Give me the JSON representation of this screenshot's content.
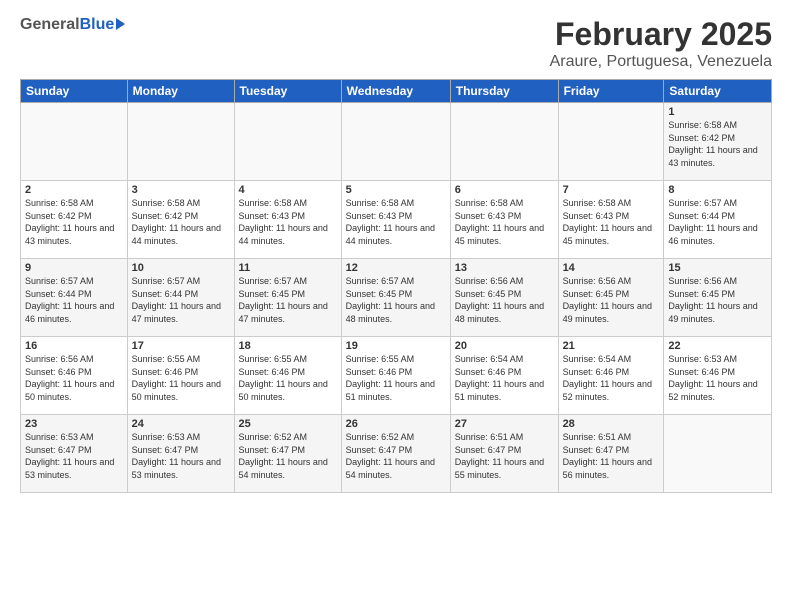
{
  "header": {
    "logo_general": "General",
    "logo_blue": "Blue",
    "title": "February 2025",
    "subtitle": "Araure, Portuguesa, Venezuela"
  },
  "days_of_week": [
    "Sunday",
    "Monday",
    "Tuesday",
    "Wednesday",
    "Thursday",
    "Friday",
    "Saturday"
  ],
  "weeks": [
    [
      {
        "day": "",
        "info": ""
      },
      {
        "day": "",
        "info": ""
      },
      {
        "day": "",
        "info": ""
      },
      {
        "day": "",
        "info": ""
      },
      {
        "day": "",
        "info": ""
      },
      {
        "day": "",
        "info": ""
      },
      {
        "day": "1",
        "info": "Sunrise: 6:58 AM\nSunset: 6:42 PM\nDaylight: 11 hours and 43 minutes."
      }
    ],
    [
      {
        "day": "2",
        "info": "Sunrise: 6:58 AM\nSunset: 6:42 PM\nDaylight: 11 hours and 43 minutes."
      },
      {
        "day": "3",
        "info": "Sunrise: 6:58 AM\nSunset: 6:42 PM\nDaylight: 11 hours and 44 minutes."
      },
      {
        "day": "4",
        "info": "Sunrise: 6:58 AM\nSunset: 6:43 PM\nDaylight: 11 hours and 44 minutes."
      },
      {
        "day": "5",
        "info": "Sunrise: 6:58 AM\nSunset: 6:43 PM\nDaylight: 11 hours and 44 minutes."
      },
      {
        "day": "6",
        "info": "Sunrise: 6:58 AM\nSunset: 6:43 PM\nDaylight: 11 hours and 45 minutes."
      },
      {
        "day": "7",
        "info": "Sunrise: 6:58 AM\nSunset: 6:43 PM\nDaylight: 11 hours and 45 minutes."
      },
      {
        "day": "8",
        "info": "Sunrise: 6:57 AM\nSunset: 6:44 PM\nDaylight: 11 hours and 46 minutes."
      }
    ],
    [
      {
        "day": "9",
        "info": "Sunrise: 6:57 AM\nSunset: 6:44 PM\nDaylight: 11 hours and 46 minutes."
      },
      {
        "day": "10",
        "info": "Sunrise: 6:57 AM\nSunset: 6:44 PM\nDaylight: 11 hours and 47 minutes."
      },
      {
        "day": "11",
        "info": "Sunrise: 6:57 AM\nSunset: 6:45 PM\nDaylight: 11 hours and 47 minutes."
      },
      {
        "day": "12",
        "info": "Sunrise: 6:57 AM\nSunset: 6:45 PM\nDaylight: 11 hours and 48 minutes."
      },
      {
        "day": "13",
        "info": "Sunrise: 6:56 AM\nSunset: 6:45 PM\nDaylight: 11 hours and 48 minutes."
      },
      {
        "day": "14",
        "info": "Sunrise: 6:56 AM\nSunset: 6:45 PM\nDaylight: 11 hours and 49 minutes."
      },
      {
        "day": "15",
        "info": "Sunrise: 6:56 AM\nSunset: 6:45 PM\nDaylight: 11 hours and 49 minutes."
      }
    ],
    [
      {
        "day": "16",
        "info": "Sunrise: 6:56 AM\nSunset: 6:46 PM\nDaylight: 11 hours and 50 minutes."
      },
      {
        "day": "17",
        "info": "Sunrise: 6:55 AM\nSunset: 6:46 PM\nDaylight: 11 hours and 50 minutes."
      },
      {
        "day": "18",
        "info": "Sunrise: 6:55 AM\nSunset: 6:46 PM\nDaylight: 11 hours and 50 minutes."
      },
      {
        "day": "19",
        "info": "Sunrise: 6:55 AM\nSunset: 6:46 PM\nDaylight: 11 hours and 51 minutes."
      },
      {
        "day": "20",
        "info": "Sunrise: 6:54 AM\nSunset: 6:46 PM\nDaylight: 11 hours and 51 minutes."
      },
      {
        "day": "21",
        "info": "Sunrise: 6:54 AM\nSunset: 6:46 PM\nDaylight: 11 hours and 52 minutes."
      },
      {
        "day": "22",
        "info": "Sunrise: 6:53 AM\nSunset: 6:46 PM\nDaylight: 11 hours and 52 minutes."
      }
    ],
    [
      {
        "day": "23",
        "info": "Sunrise: 6:53 AM\nSunset: 6:47 PM\nDaylight: 11 hours and 53 minutes."
      },
      {
        "day": "24",
        "info": "Sunrise: 6:53 AM\nSunset: 6:47 PM\nDaylight: 11 hours and 53 minutes."
      },
      {
        "day": "25",
        "info": "Sunrise: 6:52 AM\nSunset: 6:47 PM\nDaylight: 11 hours and 54 minutes."
      },
      {
        "day": "26",
        "info": "Sunrise: 6:52 AM\nSunset: 6:47 PM\nDaylight: 11 hours and 54 minutes."
      },
      {
        "day": "27",
        "info": "Sunrise: 6:51 AM\nSunset: 6:47 PM\nDaylight: 11 hours and 55 minutes."
      },
      {
        "day": "28",
        "info": "Sunrise: 6:51 AM\nSunset: 6:47 PM\nDaylight: 11 hours and 56 minutes."
      },
      {
        "day": "",
        "info": ""
      }
    ]
  ]
}
